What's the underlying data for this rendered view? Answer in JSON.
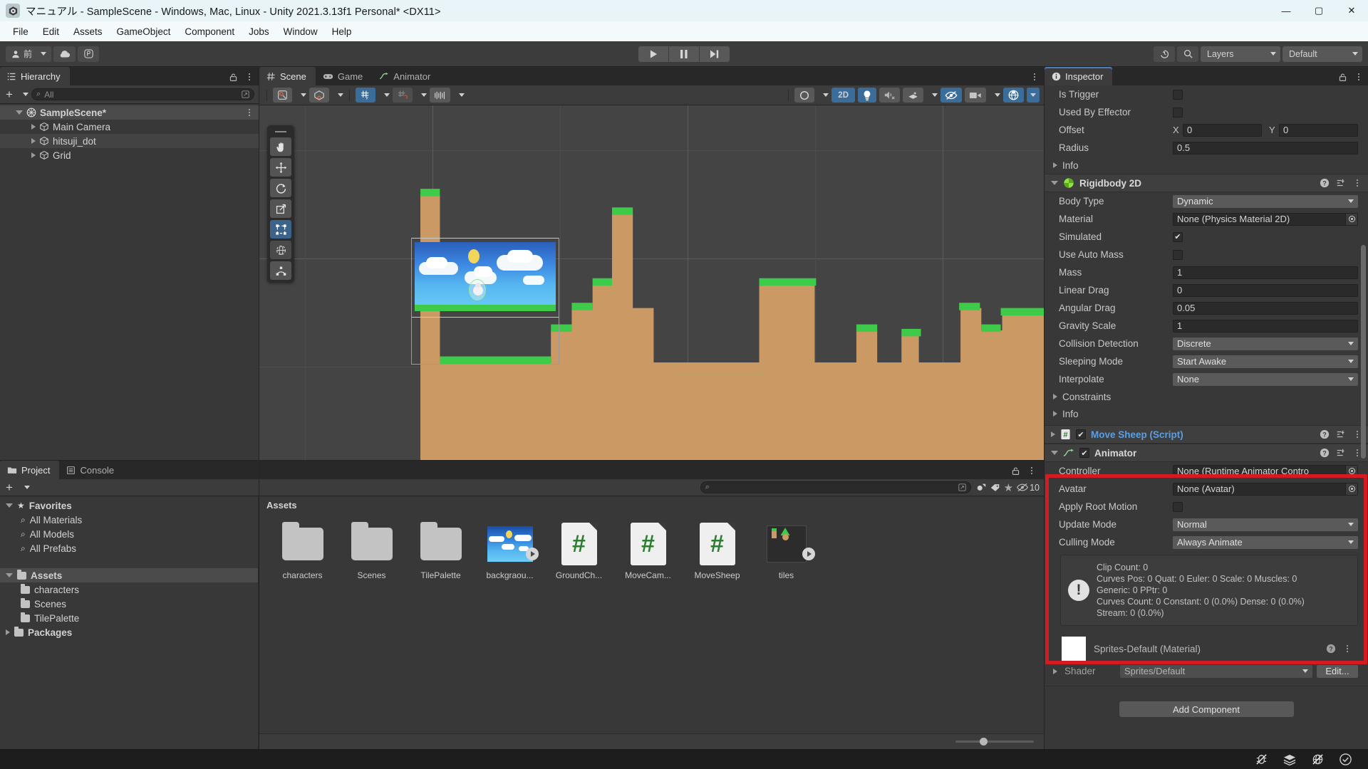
{
  "window": {
    "title": "マニュアル - SampleScene - Windows, Mac, Linux - Unity 2021.3.13f1 Personal* <DX11>",
    "minimize": "—",
    "maximize": "▢",
    "close": "✕"
  },
  "menubar": {
    "items": [
      "File",
      "Edit",
      "Assets",
      "GameObject",
      "Component",
      "Jobs",
      "Window",
      "Help"
    ]
  },
  "toolbar": {
    "account_label": "前",
    "cloud_icon": "cloud-icon",
    "collab_icon": "collab-icon",
    "play": "▶",
    "pause": "❚❚",
    "step": "▶❚",
    "history_icon": "undo-history-icon",
    "search_icon": "search-icon",
    "layers_label": "Layers",
    "layout_label": "Default"
  },
  "hierarchy": {
    "tab": "Hierarchy",
    "search_placeholder": "All",
    "items": [
      {
        "label": "SampleScene*",
        "depth": 0,
        "bold": true,
        "selected": true,
        "expanded": true
      },
      {
        "label": "Main Camera",
        "depth": 1,
        "bold": false,
        "selected": false,
        "expanded": false
      },
      {
        "label": "hitsuji_dot",
        "depth": 1,
        "bold": false,
        "selected": false,
        "expanded": false,
        "highlighted": true
      },
      {
        "label": "Grid",
        "depth": 1,
        "bold": false,
        "selected": false,
        "expanded": false
      }
    ]
  },
  "scene": {
    "tabs": [
      {
        "label": "Scene",
        "icon": "grid-icon",
        "selected": true
      },
      {
        "label": "Game",
        "icon": "gamepad-icon",
        "selected": false
      },
      {
        "label": "Animator",
        "icon": "animator-icon",
        "selected": false
      }
    ],
    "toolbar_left": [
      "shading-mode-icon",
      "2d-mode-icon",
      "gizmo-icon",
      "grid-snap-icon",
      "snap-increment-icon",
      "ruler-icon"
    ],
    "toolbar_right": [
      "draw-mode-dropdown",
      "2D",
      "lighting-toggle",
      "audio-toggle",
      "fx-dropdown",
      "hidden-objects-toggle",
      "camera-dropdown",
      "gizmos-dropdown"
    ],
    "twod_label": "2D",
    "tools": [
      "hand-tool",
      "move-tool",
      "rotate-tool",
      "scale-tool",
      "rect-tool",
      "transform-tool",
      "custom-tool"
    ],
    "selected_tool_index": 4
  },
  "project": {
    "tabs": [
      {
        "label": "Project",
        "icon": "folder-icon",
        "selected": true
      },
      {
        "label": "Console",
        "icon": "console-icon",
        "selected": false
      }
    ],
    "search_placeholder": "",
    "hidden_count": "10",
    "tree": [
      {
        "label": "Favorites",
        "icon": "star-icon",
        "depth": 0,
        "bold": true,
        "expanded": true
      },
      {
        "label": "All Materials",
        "icon": "search-icon",
        "depth": 1,
        "bold": false
      },
      {
        "label": "All Models",
        "icon": "search-icon",
        "depth": 1,
        "bold": false
      },
      {
        "label": "All Prefabs",
        "icon": "search-icon",
        "depth": 1,
        "bold": false
      },
      {
        "label": "Assets",
        "icon": "folder-open-icon",
        "depth": 0,
        "bold": true,
        "expanded": true,
        "selected": true
      },
      {
        "label": "characters",
        "icon": "folder-icon",
        "depth": 1,
        "bold": false
      },
      {
        "label": "Scenes",
        "icon": "folder-icon",
        "depth": 1,
        "bold": false
      },
      {
        "label": "TilePalette",
        "icon": "folder-icon",
        "depth": 1,
        "bold": false
      },
      {
        "label": "Packages",
        "icon": "folder-icon",
        "depth": 0,
        "bold": true,
        "expanded": false
      }
    ],
    "breadcrumb": "Assets",
    "assets": [
      {
        "label": "characters",
        "type": "folder"
      },
      {
        "label": "Scenes",
        "type": "folder"
      },
      {
        "label": "TilePalette",
        "type": "folder"
      },
      {
        "label": "backgraou...",
        "type": "sprite-sheet"
      },
      {
        "label": "GroundCh...",
        "type": "script"
      },
      {
        "label": "MoveCam...",
        "type": "script"
      },
      {
        "label": "MoveSheep",
        "type": "script"
      },
      {
        "label": "tiles",
        "type": "tile-sheet"
      }
    ]
  },
  "inspector": {
    "tab": "Inspector",
    "collider": {
      "rows": [
        {
          "label": "Is Trigger",
          "type": "checkbox",
          "checked": false
        },
        {
          "label": "Used By Effector",
          "type": "checkbox",
          "checked": false
        },
        {
          "label": "Offset",
          "type": "vector2",
          "x_label": "X",
          "x": "0",
          "y_label": "Y",
          "y": "0"
        },
        {
          "label": "Radius",
          "type": "text",
          "value": "0.5"
        }
      ],
      "info_label": "Info"
    },
    "rigidbody": {
      "title": "Rigidbody 2D",
      "icon": "rigidbody2d-icon",
      "rows": [
        {
          "label": "Body Type",
          "type": "dropdown",
          "value": "Dynamic"
        },
        {
          "label": "Material",
          "type": "object",
          "value": "None (Physics Material 2D)"
        },
        {
          "label": "Simulated",
          "type": "checkbox",
          "checked": true
        },
        {
          "label": "Use Auto Mass",
          "type": "checkbox",
          "checked": false
        },
        {
          "label": "Mass",
          "type": "text",
          "value": "1"
        },
        {
          "label": "Linear Drag",
          "type": "text",
          "value": "0"
        },
        {
          "label": "Angular Drag",
          "type": "text",
          "value": "0.05"
        },
        {
          "label": "Gravity Scale",
          "type": "text",
          "value": "1"
        },
        {
          "label": "Collision Detection",
          "type": "dropdown",
          "value": "Discrete"
        },
        {
          "label": "Sleeping Mode",
          "type": "dropdown",
          "value": "Start Awake"
        },
        {
          "label": "Interpolate",
          "type": "dropdown",
          "value": "None"
        }
      ],
      "constraints_label": "Constraints",
      "info_label": "Info"
    },
    "script_component": {
      "title": "Move Sheep (Script)",
      "enabled": true,
      "icon": "csharp-script-icon"
    },
    "animator": {
      "title": "Animator",
      "enabled": true,
      "icon": "animator-icon",
      "rows": [
        {
          "label": "Controller",
          "type": "object",
          "value": "None (Runtime Animator Contro"
        },
        {
          "label": "Avatar",
          "type": "object",
          "value": "None (Avatar)"
        },
        {
          "label": "Apply Root Motion",
          "type": "checkbox",
          "checked": false
        },
        {
          "label": "Update Mode",
          "type": "dropdown",
          "value": "Normal"
        },
        {
          "label": "Culling Mode",
          "type": "dropdown",
          "value": "Always Animate"
        }
      ],
      "info_lines": [
        "Clip Count: 0",
        "Curves Pos: 0 Quat: 0 Euler: 0 Scale: 0 Muscles: 0",
        "Generic: 0 PPtr: 0",
        "Curves Count: 0 Constant: 0 (0.0%) Dense: 0 (0.0%)",
        "Stream: 0 (0.0%)"
      ],
      "highlight_color": "#d31c21"
    },
    "material": {
      "title": "Sprites-Default (Material)",
      "shader_label": "Shader",
      "shader_value": "Sprites/Default",
      "edit_label": "Edit..."
    },
    "add_component_label": "Add Component"
  },
  "statusbar": {
    "icons": [
      "mute-bug-icon",
      "layers-stack-icon",
      "no-preview-icon",
      "check-circle-icon"
    ]
  }
}
